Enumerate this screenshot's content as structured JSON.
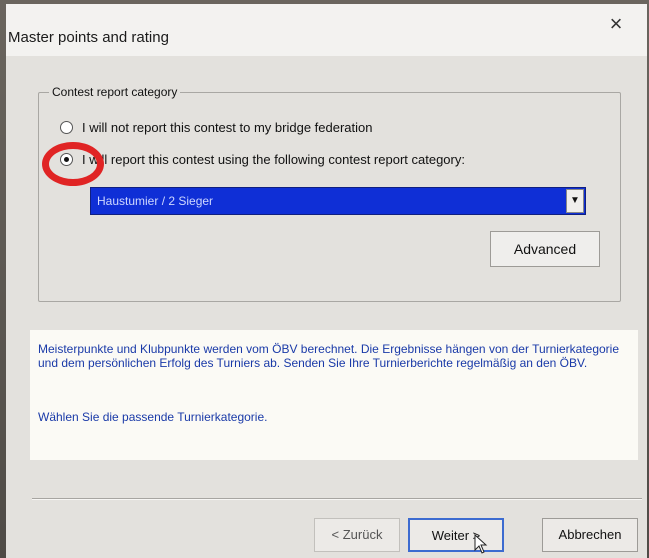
{
  "window": {
    "title": "Master points and rating",
    "close_symbol": "×"
  },
  "group": {
    "legend": "Contest report category",
    "radio_options": [
      {
        "label": "I will not report this contest to my bridge federation",
        "checked": false
      },
      {
        "label": "I will report this contest using the following contest report category:",
        "checked": true
      }
    ],
    "category_select": {
      "value": "Haustumier / 2 Sieger",
      "arrow": "▼"
    },
    "advanced_label": "Advanced"
  },
  "info": {
    "paragraph1": "Meisterpunkte und Klubpunkte werden vom ÖBV berechnet. Die Ergebnisse hängen von der Turnierkategorie und dem persönlichen Erfolg des Turniers ab. Senden Sie Ihre Turnierberichte regelmäßig an den ÖBV.",
    "paragraph2": "Wählen Sie die passende Turnierkategorie."
  },
  "buttons": {
    "back_label": "< Zurück",
    "next_label": "Weiter >",
    "cancel_label": "Abbrechen"
  },
  "colors": {
    "annotation_circle": "#e02424",
    "select_highlight": "#0f2fd6",
    "info_text": "#1a3aa8"
  },
  "icons": {
    "close": "close-icon",
    "dropdown": "chevron-down-icon",
    "pointer": "mouse-cursor-icon"
  }
}
